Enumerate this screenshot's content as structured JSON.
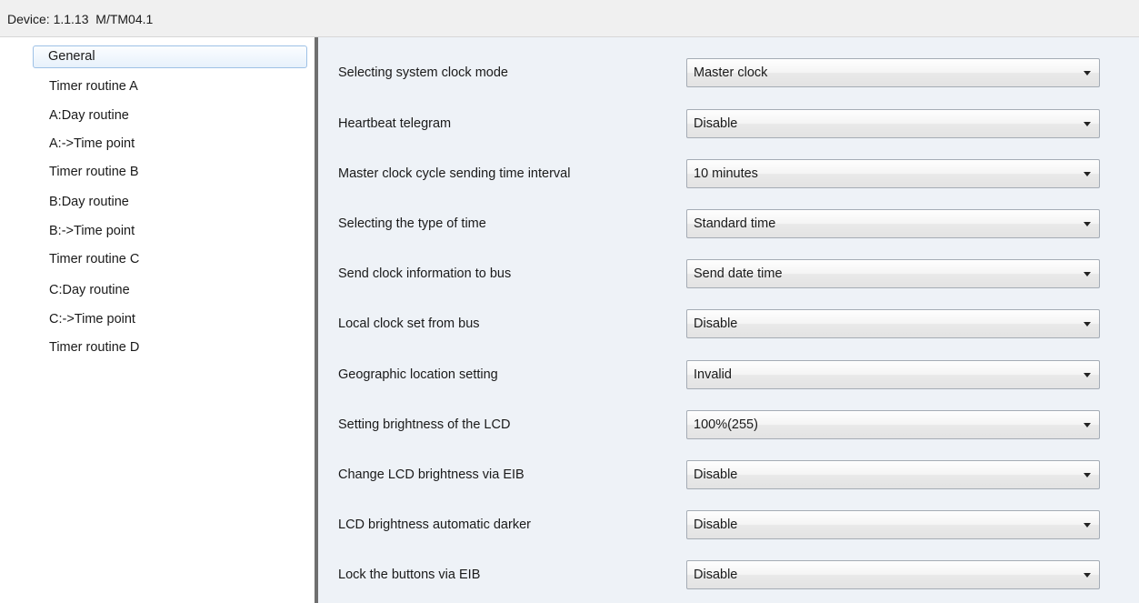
{
  "window": {
    "title": "Device: 1.1.13  M/TM04.1"
  },
  "sidebar": {
    "items": [
      {
        "label": "General",
        "selected": true
      },
      {
        "label": "Timer routine A"
      },
      {
        "label": "A:Day routine"
      },
      {
        "label": "A:->Time point"
      },
      {
        "label": "Timer routine B"
      },
      {
        "label": "B:Day routine"
      },
      {
        "label": "B:->Time point"
      },
      {
        "label": "Timer routine C"
      },
      {
        "label": "C:Day routine"
      },
      {
        "label": "C:->Time point"
      },
      {
        "label": "Timer routine D"
      }
    ]
  },
  "params": [
    {
      "label": "Selecting system clock mode",
      "value": "Master clock"
    },
    {
      "label": "Heartbeat telegram",
      "value": "Disable"
    },
    {
      "label": "Master clock cycle sending time interval",
      "value": "10 minutes"
    },
    {
      "label": "Selecting the type of time",
      "value": "Standard time"
    },
    {
      "label": "Send clock information to bus",
      "value": "Send date time"
    },
    {
      "label": "Local clock set from bus",
      "value": "Disable"
    },
    {
      "label": "Geographic location setting",
      "value": "Invalid"
    },
    {
      "label": "Setting brightness of the LCD",
      "value": "100%(255)"
    },
    {
      "label": "Change LCD brightness via EIB",
      "value": "Disable"
    },
    {
      "label": "LCD brightness automatic darker",
      "value": "Disable"
    },
    {
      "label": "Lock the buttons via EIB",
      "value": "Disable"
    }
  ],
  "colors": {
    "content_background": "#eef2f7",
    "selection_border": "#9ec1e6",
    "divider": "#6f6f6f"
  },
  "icons": {
    "dropdown": "chevron-down-icon"
  }
}
